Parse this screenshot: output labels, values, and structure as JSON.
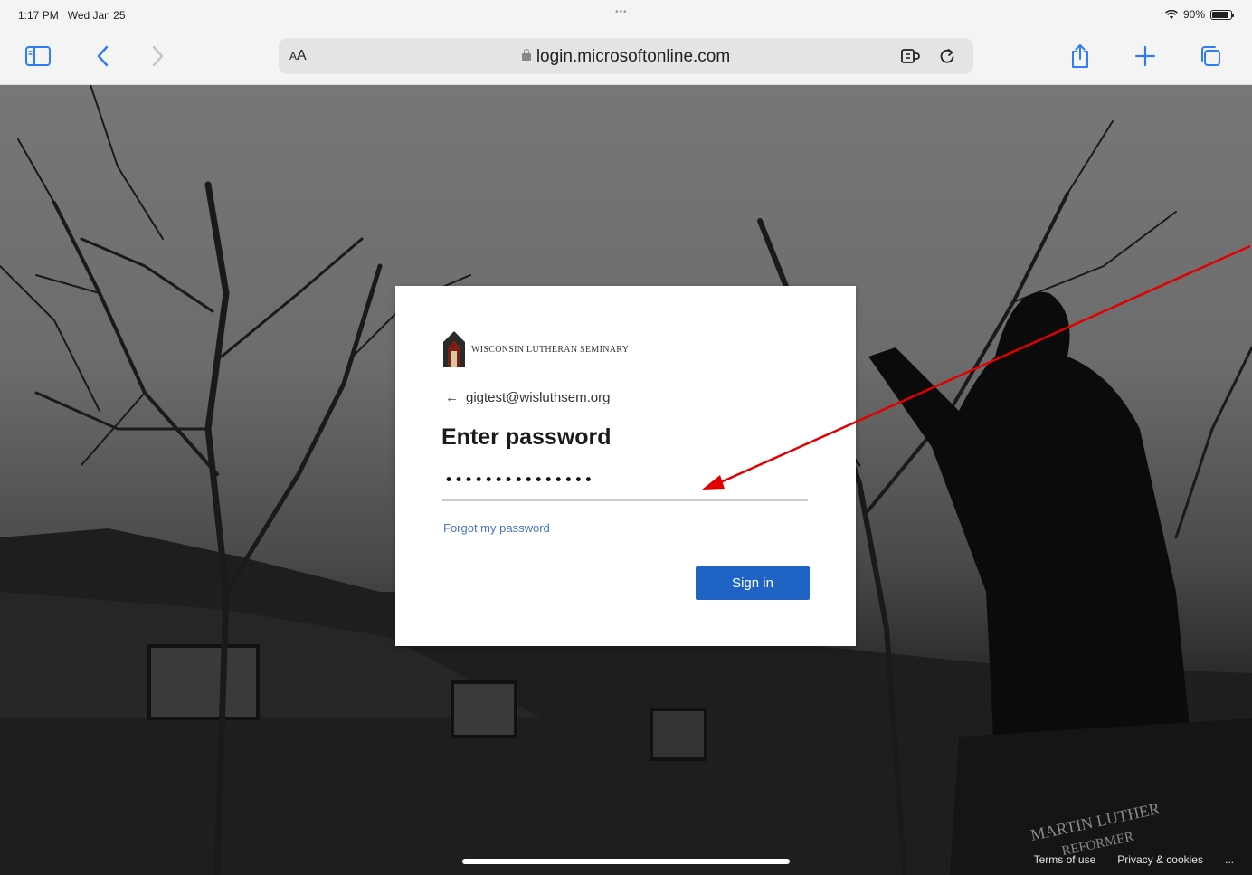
{
  "status_bar": {
    "time": "1:17 PM",
    "date": "Wed Jan 25",
    "center_dots": "•••",
    "battery_percent": "90%",
    "battery_level": 0.9
  },
  "browser": {
    "text_size_label_small": "A",
    "text_size_label_large": "A",
    "url": "login.microsoftonline.com",
    "accent_color": "#2f7cf6"
  },
  "login": {
    "org_name": "WISCONSIN LUTHERAN SEMINARY",
    "back_arrow": "←",
    "identity": "gigtest@wisluthsem.org",
    "title": "Enter password",
    "password_value": "•••••••••••••••",
    "forgot_link": "Forgot my password",
    "signin_button": "Sign in",
    "button_color": "#1f64c4",
    "link_color": "#4a74c0"
  },
  "footer": {
    "terms": "Terms of use",
    "privacy": "Privacy & cookies",
    "more": "..."
  },
  "annotation": {
    "color": "#e00000"
  }
}
